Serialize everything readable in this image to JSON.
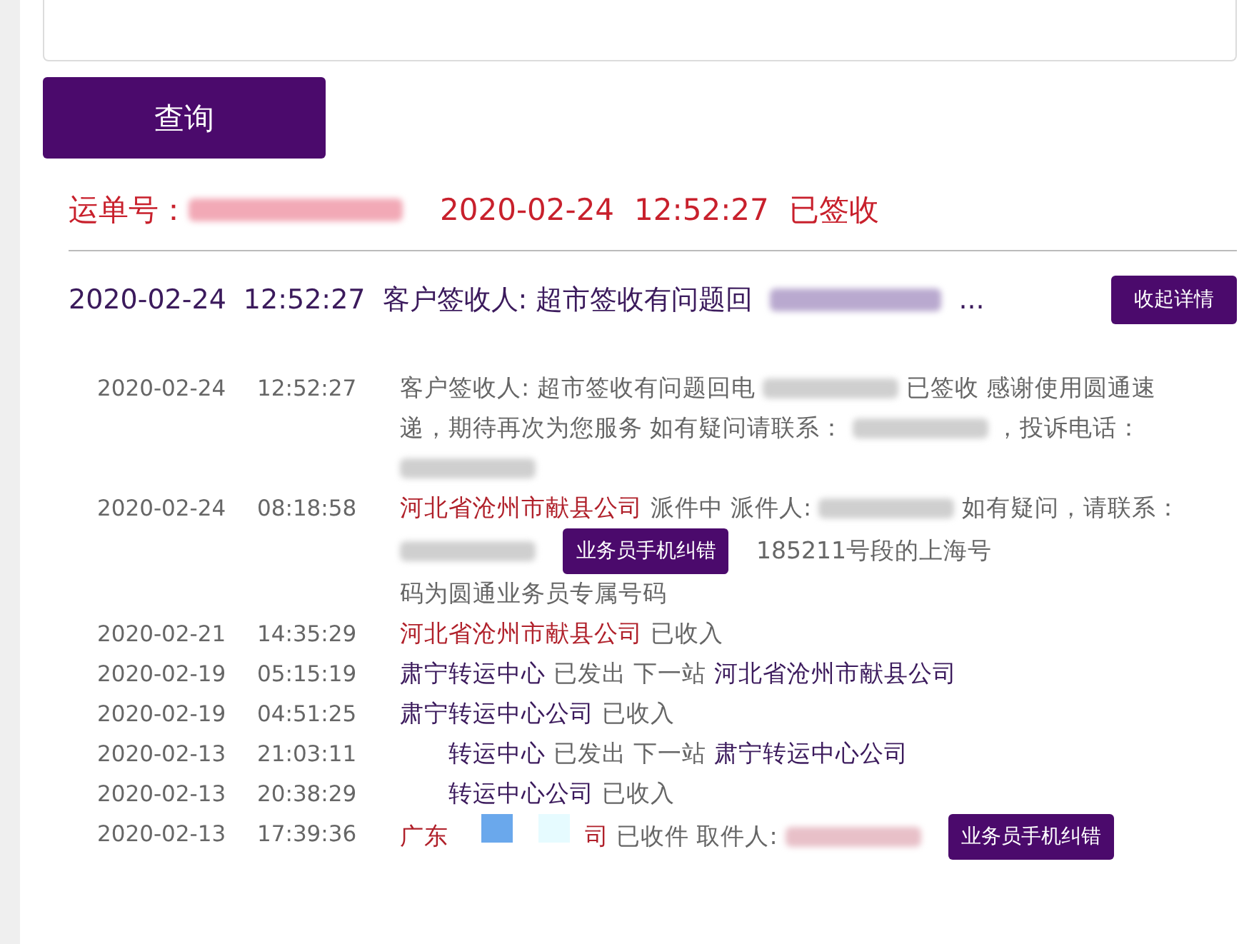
{
  "query_button": "查询",
  "waybill": {
    "label": "运单号：",
    "number_redaction": {
      "color": "#f2a9b6"
    },
    "date": "2020-02-24",
    "time": "12:52:27",
    "status": "已签收"
  },
  "summary": {
    "date": "2020-02-24",
    "time": "12:52:27",
    "text": "客户签收人: 超市签收有问题回",
    "redaction": {
      "color": "#b9a9cf"
    },
    "ellipsis": "...",
    "button": "收起详情"
  },
  "events": [
    {
      "date": "2020-02-24",
      "time": "12:52:27",
      "segments": [
        {
          "kind": "plain",
          "text": "客户签收人: 超市签收有问题回电"
        },
        {
          "kind": "redacted",
          "color": "#cfcfcf"
        },
        {
          "kind": "plain",
          "text": "已签收 感谢使用圆通速"
        },
        {
          "kind": "plain",
          "text": "递，期待再次为您服务 如有疑问请联系："
        },
        {
          "kind": "redacted",
          "color": "#cfcfcf"
        },
        {
          "kind": "plain",
          "text": "，投诉电话："
        },
        {
          "kind": "redacted",
          "color": "#cfcfcf"
        }
      ]
    },
    {
      "date": "2020-02-24",
      "time": "08:18:58",
      "segments": [
        {
          "kind": "org",
          "text": "河北省沧州市献县公司"
        },
        {
          "kind": "plain",
          "text": "派件中 派件人:"
        },
        {
          "kind": "redacted",
          "color": "#cfcfcf"
        },
        {
          "kind": "plain",
          "text": "如有疑"
        },
        {
          "kind": "plain",
          "text": "问，请联系："
        },
        {
          "kind": "redacted",
          "color": "#cfcfcf"
        },
        {
          "kind": "button",
          "text": "业务员手机纠错"
        },
        {
          "kind": "plain",
          "text": "185211号段的上海号"
        },
        {
          "kind": "plain",
          "text": "码为圆通业务员专属号码"
        }
      ]
    },
    {
      "date": "2020-02-21",
      "time": "14:35:29",
      "segments": [
        {
          "kind": "org",
          "text": "河北省沧州市献县公司"
        },
        {
          "kind": "plain",
          "text": "已收入"
        }
      ]
    },
    {
      "date": "2020-02-19",
      "time": "05:15:19",
      "segments": [
        {
          "kind": "hub",
          "text": "肃宁转运中心"
        },
        {
          "kind": "plain",
          "text": "已发出 下一站"
        },
        {
          "kind": "hub",
          "text": "河北省沧州市献县公司"
        }
      ]
    },
    {
      "date": "2020-02-19",
      "time": "04:51:25",
      "segments": [
        {
          "kind": "hub",
          "text": "肃宁转运中心公司"
        },
        {
          "kind": "plain",
          "text": "已收入"
        }
      ]
    },
    {
      "date": "2020-02-13",
      "time": "21:03:11",
      "segments": [
        {
          "kind": "covered"
        },
        {
          "kind": "hub",
          "text": "转运中心"
        },
        {
          "kind": "plain",
          "text": "已发出 下一站"
        },
        {
          "kind": "hub",
          "text": "肃宁转运中心公司"
        }
      ]
    },
    {
      "date": "2020-02-13",
      "time": "20:38:29",
      "segments": [
        {
          "kind": "covered"
        },
        {
          "kind": "hub",
          "text": "转运中心公司"
        },
        {
          "kind": "plain",
          "text": "已收入"
        }
      ]
    },
    {
      "date": "2020-02-13",
      "time": "17:39:36",
      "segments": [
        {
          "kind": "org",
          "text": "广东"
        },
        {
          "kind": "sticker"
        },
        {
          "kind": "org",
          "text": "司"
        },
        {
          "kind": "plain",
          "text": "已收件 取件人:"
        },
        {
          "kind": "redacted",
          "color": "#e8c0c8"
        },
        {
          "kind": "button",
          "text": "业务员手机纠错"
        }
      ]
    }
  ]
}
